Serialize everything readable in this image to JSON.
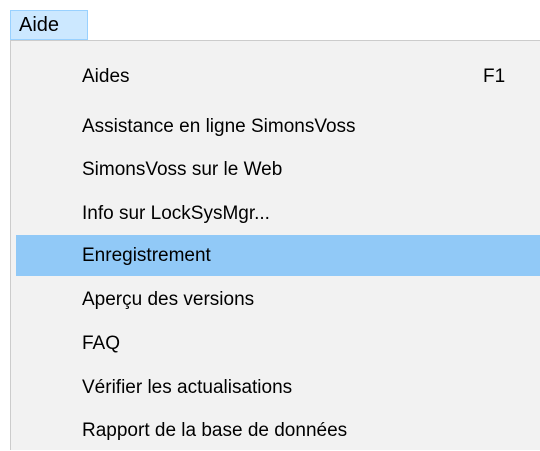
{
  "menubar": {
    "help_label": "Aide"
  },
  "menu": {
    "items": [
      {
        "label": "Aides",
        "shortcut": "F1"
      },
      {
        "label": "Assistance en ligne SimonsVoss"
      },
      {
        "label": "SimonsVoss sur le Web"
      },
      {
        "label": "Info sur LockSysMgr..."
      },
      {
        "label": "Enregistrement",
        "highlighted": true
      },
      {
        "label": "Aperçu des versions"
      },
      {
        "label": "FAQ"
      },
      {
        "label": "Vérifier les actualisations"
      },
      {
        "label": "Rapport de la base de données"
      }
    ]
  },
  "colors": {
    "menubar_active_bg": "#cce8ff",
    "menubar_active_border": "#99d1ff",
    "menu_bg": "#f2f2f2",
    "highlight_bg": "#91c9f7"
  }
}
